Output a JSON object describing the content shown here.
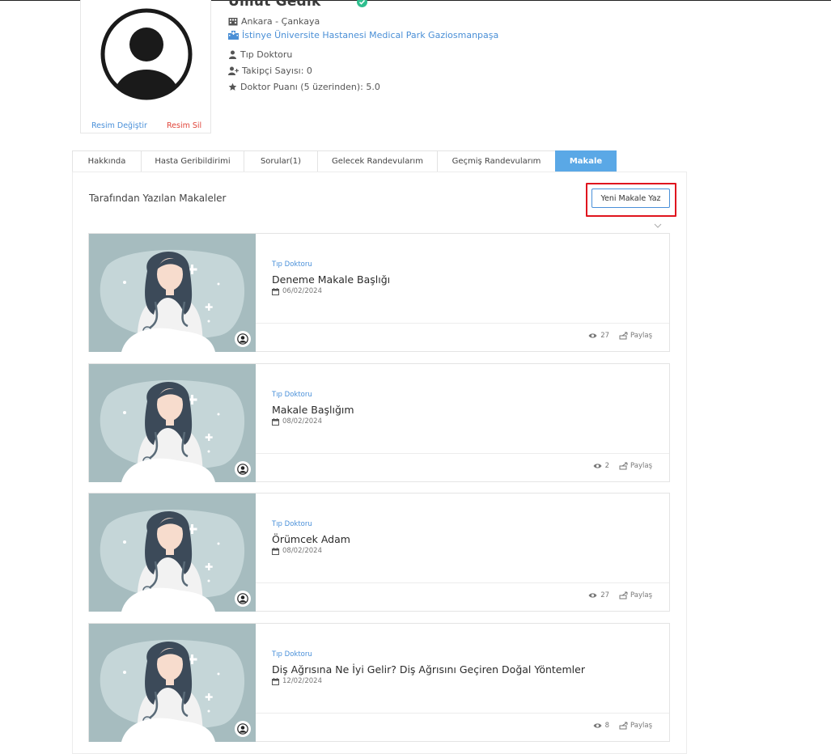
{
  "profile": {
    "name": "Umut Gedik",
    "location": "Ankara - Çankaya",
    "hospital": "İstinye Üniversite Hastanesi Medical Park Gaziosmanpaşa",
    "specialty": "Tıp Doktoru",
    "followers": "Takipçi Sayısı: 0",
    "rating": "Doktor Puanı (5 üzerinden): 5.0",
    "change_photo": "Resim Değiştir",
    "remove_photo": "Resim Sil"
  },
  "tabs": [
    {
      "label": "Hakkında"
    },
    {
      "label": "Hasta Geribildirimi"
    },
    {
      "label": "Sorular(1)"
    },
    {
      "label": "Gelecek Randevularım"
    },
    {
      "label": "Geçmiş Randevularım"
    },
    {
      "label": "Makale"
    }
  ],
  "articles_section": {
    "title": "Tarafından Yazılan Makaleler",
    "new_button": "Yeni Makale Yaz"
  },
  "articles": [
    {
      "category": "Tıp Doktoru",
      "title": "Deneme Makale Başlığı",
      "date": "06/02/2024",
      "views": "27",
      "share": "Paylaş"
    },
    {
      "category": "Tıp Doktoru",
      "title": "Makale Başlığım",
      "date": "08/02/2024",
      "views": "2",
      "share": "Paylaş"
    },
    {
      "category": "Tıp Doktoru",
      "title": "Örümcek Adam",
      "date": "08/02/2024",
      "views": "27",
      "share": "Paylaş"
    },
    {
      "category": "Tıp Doktoru",
      "title": "Diş Ağrısına Ne İyi Gelir? Diş Ağrısını Geçiren Doğal Yöntemler",
      "date": "12/02/2024",
      "views": "8",
      "share": "Paylaş"
    }
  ],
  "colors": {
    "accent": "#5aa8e6",
    "link": "#4a90d9",
    "danger": "#e0453a",
    "highlight": "#e0141e",
    "verified": "#2fbf8f"
  }
}
